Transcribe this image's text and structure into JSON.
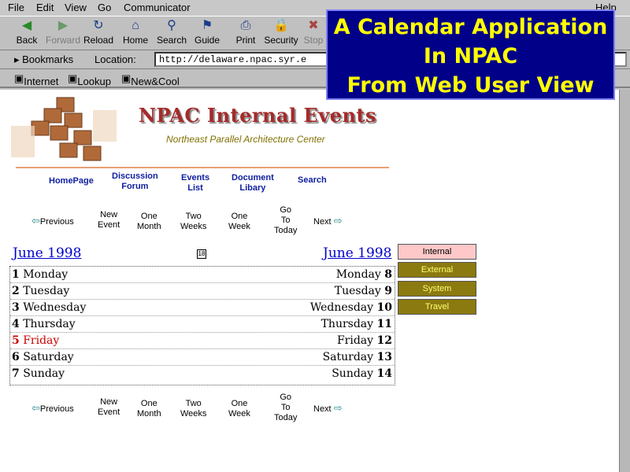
{
  "menu": {
    "file": "File",
    "edit": "Edit",
    "view": "View",
    "go": "Go",
    "communicator": "Communicator",
    "help": "Help"
  },
  "toolbar": {
    "back": "Back",
    "forward": "Forward",
    "reload": "Reload",
    "home": "Home",
    "search": "Search",
    "guide": "Guide",
    "print": "Print",
    "security": "Security",
    "stop": "Stop"
  },
  "locbar": {
    "bookmarks": "Bookmarks",
    "location_label": "Location:",
    "url": "http://delaware.npac.syr.e"
  },
  "persbar": {
    "internet": "Internet",
    "lookup": "Lookup",
    "newcool": "New&Cool"
  },
  "overlay": {
    "line1": "A Calendar Application",
    "line2": "In NPAC",
    "line3": "From Web User View"
  },
  "site": {
    "title": "NPAC Internal Events",
    "subtitle": "Northeast Parallel Architecture Center"
  },
  "nav": {
    "homepage": "HomePage",
    "discussion_1": "Discussion",
    "discussion_2": "Forum",
    "events_1": "Events",
    "events_2": "List",
    "document_1": "Document",
    "document_2": "Libary",
    "search": "Search"
  },
  "controls": {
    "previous": "Previous",
    "new_1": "New",
    "new_2": "Event",
    "onemonth_1": "One",
    "onemonth_2": "Month",
    "twoweeks_1": "Two",
    "twoweeks_2": "Weeks",
    "oneweek_1": "One",
    "oneweek_2": "Week",
    "goto_1": "Go",
    "goto_2": "To",
    "goto_3": "Today",
    "next": "Next"
  },
  "calendar": {
    "month_left": "June 1998",
    "month_right": "June 1998",
    "small_icon": "18",
    "days": [
      {
        "num": "1",
        "name": "Monday",
        "rname": "Monday",
        "rnum": "8"
      },
      {
        "num": "2",
        "name": "Tuesday",
        "rname": "Tuesday",
        "rnum": "9"
      },
      {
        "num": "3",
        "name": "Wednesday",
        "rname": "Wednesday",
        "rnum": "10"
      },
      {
        "num": "4",
        "name": "Thursday",
        "rname": "Thursday",
        "rnum": "11"
      },
      {
        "num": "5",
        "name": "Friday",
        "rname": "Friday",
        "rnum": "12"
      },
      {
        "num": "6",
        "name": "Saturday",
        "rname": "Saturday",
        "rnum": "13"
      },
      {
        "num": "7",
        "name": "Sunday",
        "rname": "Sunday",
        "rnum": "14"
      }
    ]
  },
  "categories": {
    "internal": "Internal",
    "external": "External",
    "system": "System",
    "travel": "Travel",
    "internal_bg": "#ffc8c8",
    "other_bg": "#8b7a10",
    "other_fg": "#ffff70"
  },
  "colors": {
    "overlay_bg": "#000088",
    "overlay_fg": "#ffff00",
    "title": "#a52a2a",
    "link": "#0000cc"
  }
}
